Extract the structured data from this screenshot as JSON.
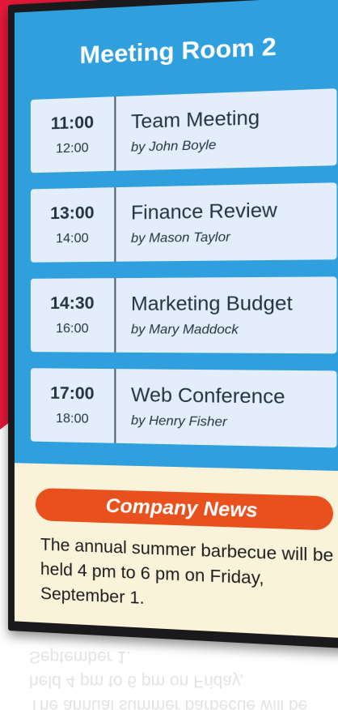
{
  "room": {
    "title": "Meeting Room 2"
  },
  "meetings": [
    {
      "start": "11:00",
      "end": "12:00",
      "title": "Team Meeting",
      "host": "by John Boyle"
    },
    {
      "start": "13:00",
      "end": "14:00",
      "title": "Finance Review",
      "host": "by Mason Taylor"
    },
    {
      "start": "14:30",
      "end": "16:00",
      "title": "Marketing Budget",
      "host": "by Mary Maddock"
    },
    {
      "start": "17:00",
      "end": "18:00",
      "title": "Web Conference",
      "host": "by Henry Fisher"
    }
  ],
  "news": {
    "heading": "Company News",
    "body": "The annual summer barbecue will be held 4 pm to 6 pm on Friday, September 1."
  },
  "colors": {
    "background_red": "#e5173a",
    "schedule_blue": "#2f9fdd",
    "card_bg": "#e3eefa",
    "news_orange": "#e8501e",
    "news_bg": "#fbf3d9"
  }
}
